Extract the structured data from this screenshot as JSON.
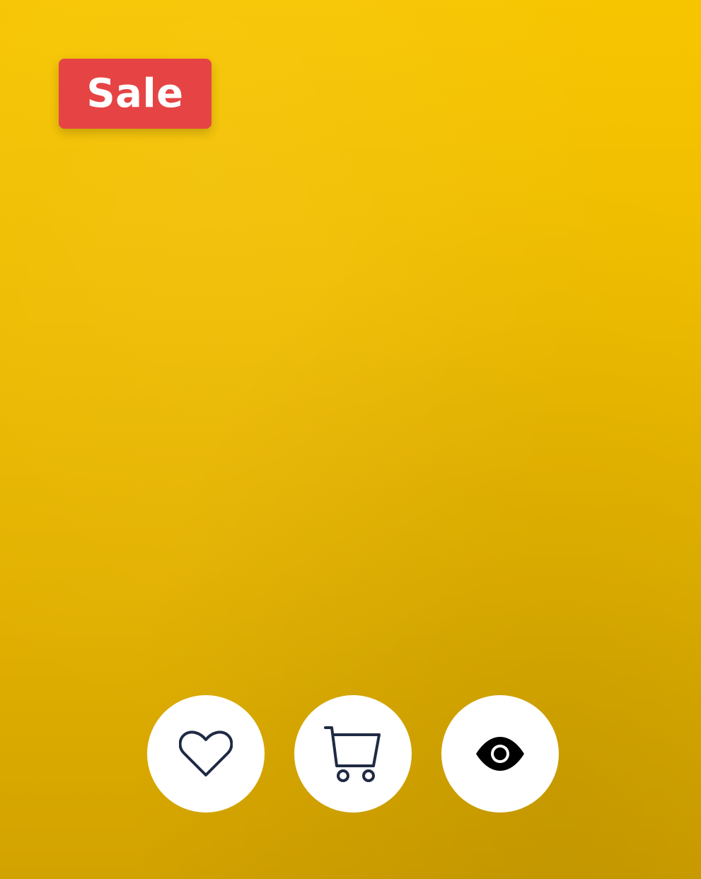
{
  "badge": {
    "label": "Sale",
    "color": "#e64444"
  },
  "colors": {
    "background": "#eebc00",
    "button_bg": "#ffffff",
    "icon_stroke": "#1f2a44"
  },
  "actions": [
    {
      "icon": "heart-icon"
    },
    {
      "icon": "cart-icon"
    },
    {
      "icon": "eye-icon"
    }
  ]
}
